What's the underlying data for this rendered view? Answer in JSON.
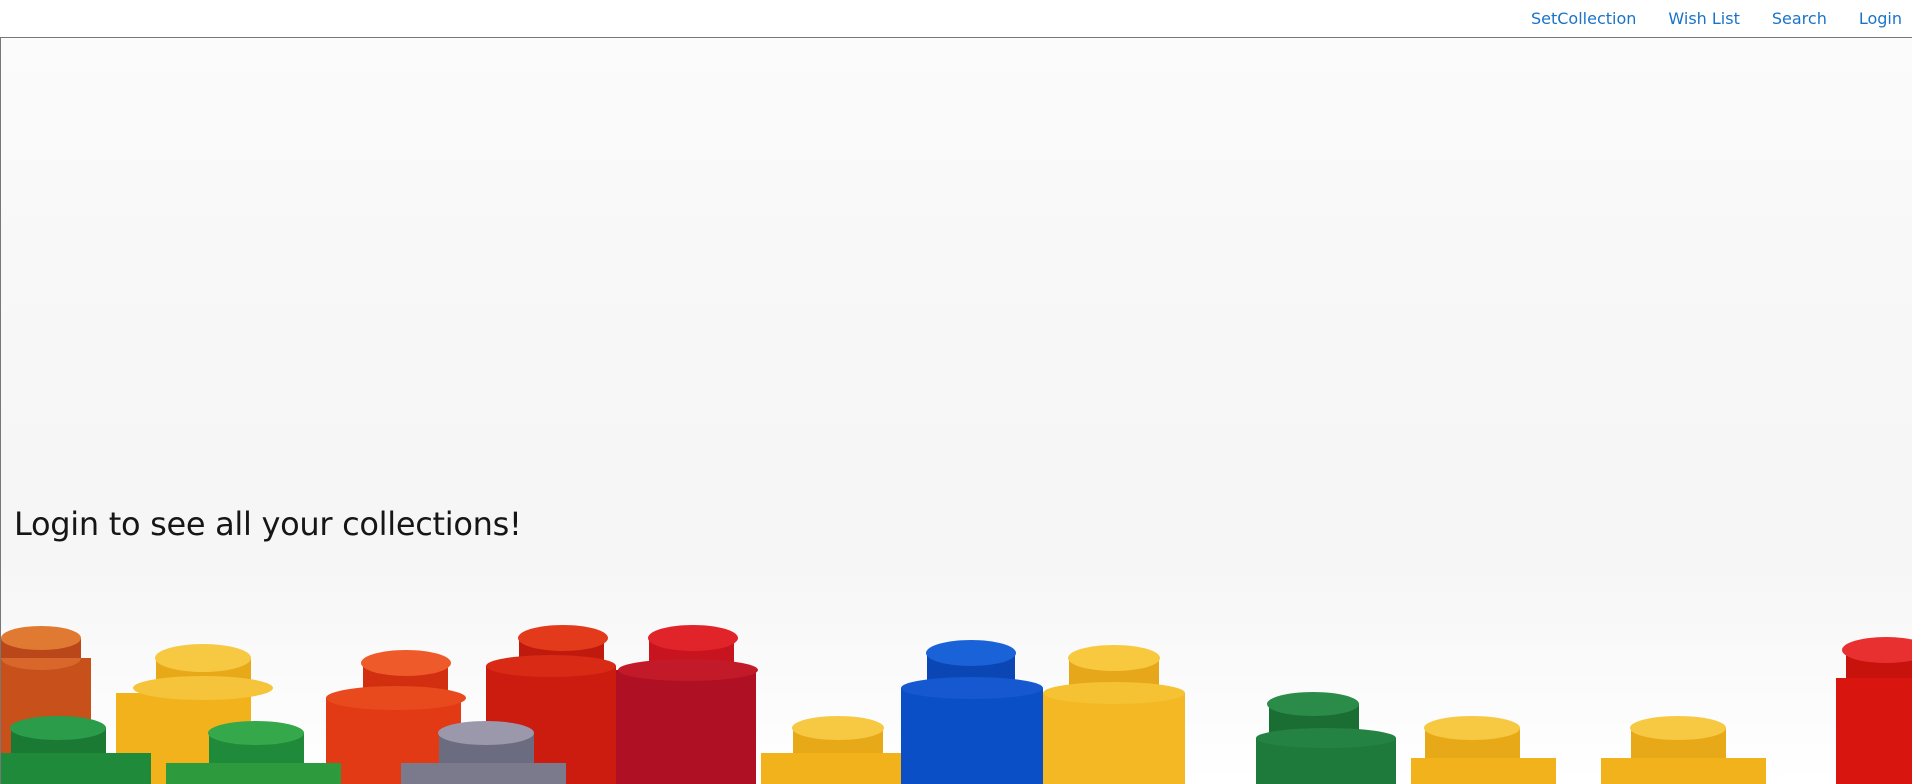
{
  "nav": {
    "links": [
      {
        "label": "SetCollection"
      },
      {
        "label": "Wish List"
      },
      {
        "label": "Search"
      },
      {
        "label": "Login"
      }
    ],
    "link_color": "#1a73c9"
  },
  "hero": {
    "message": "Login to see all your collections!",
    "background_image": "lego-bricks-photo",
    "brick_colors": [
      "#c8501a",
      "#f2b21c",
      "#e23a14",
      "#d9150f",
      "#0a4fc6",
      "#1e8a3a",
      "#7a7a8c"
    ]
  }
}
